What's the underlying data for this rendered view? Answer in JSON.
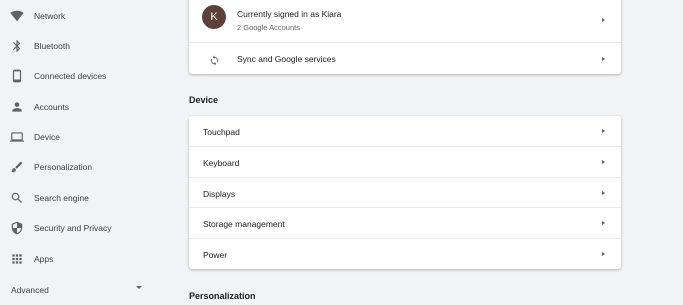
{
  "sidebar": {
    "items": [
      {
        "label": "Network",
        "icon": "wifi-icon"
      },
      {
        "label": "Bluetooth",
        "icon": "bluetooth-icon"
      },
      {
        "label": "Connected devices",
        "icon": "phone-icon"
      },
      {
        "label": "Accounts",
        "icon": "person-icon"
      },
      {
        "label": "Device",
        "icon": "laptop-icon"
      },
      {
        "label": "Personalization",
        "icon": "brush-icon"
      },
      {
        "label": "Search engine",
        "icon": "search-icon"
      },
      {
        "label": "Security and Privacy",
        "icon": "shield-icon"
      },
      {
        "label": "Apps",
        "icon": "apps-grid-icon"
      }
    ],
    "advanced_label": "Advanced"
  },
  "accounts": {
    "avatar_letter": "K",
    "signed_in_text": "Currently signed in as Kiara",
    "accounts_count": "2 Google Accounts",
    "sync_label": "Sync and Google services"
  },
  "device": {
    "section_title": "Device",
    "rows": [
      {
        "label": "Touchpad"
      },
      {
        "label": "Keyboard"
      },
      {
        "label": "Displays"
      },
      {
        "label": "Storage management"
      },
      {
        "label": "Power"
      }
    ]
  },
  "personalization": {
    "section_title": "Personalization"
  },
  "colors": {
    "background": "#f1f3f4",
    "card": "#ffffff",
    "avatar": "#5d4037",
    "icon": "#5f6368"
  }
}
